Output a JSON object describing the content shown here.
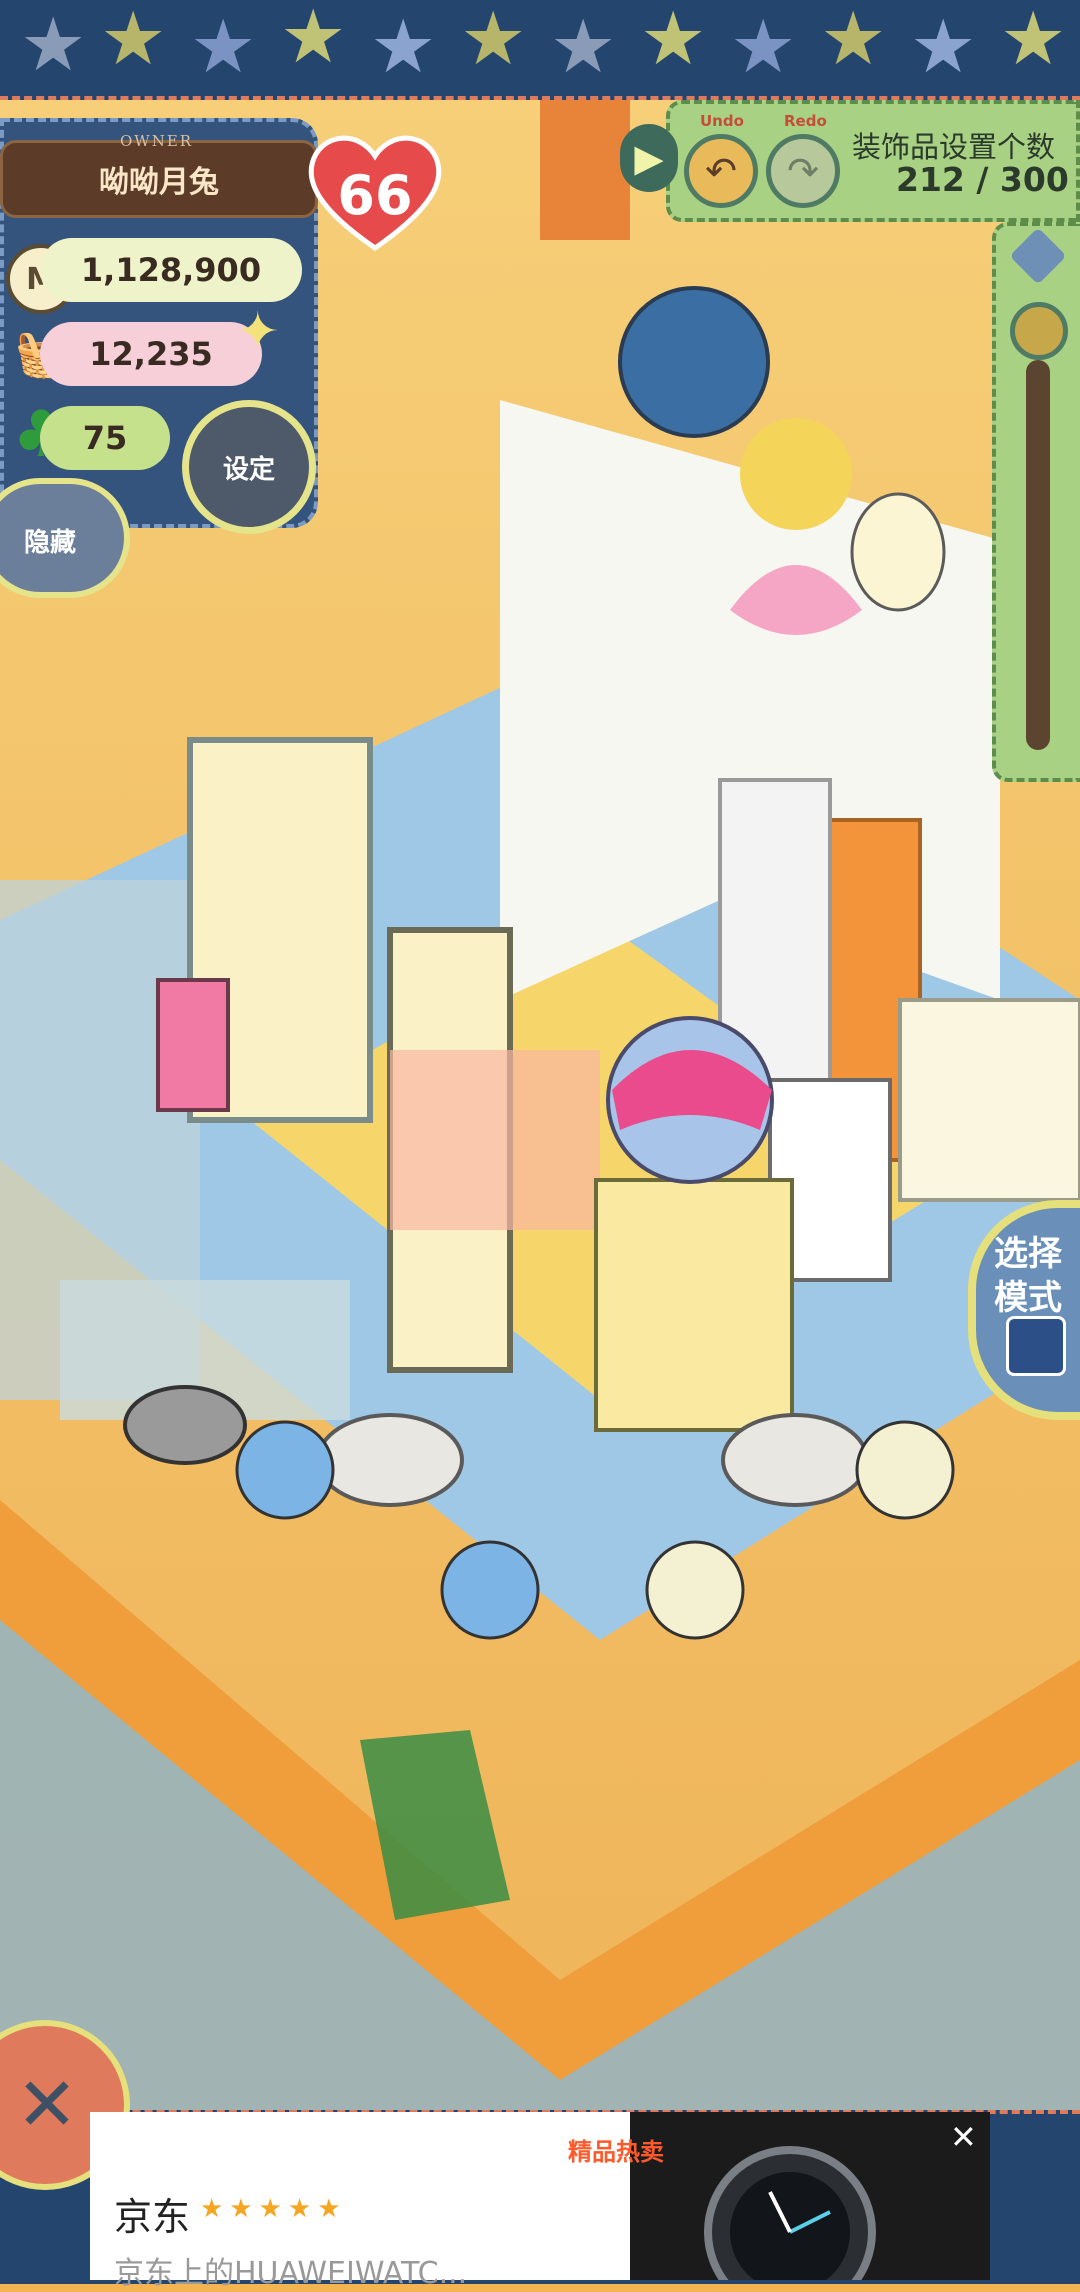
{
  "owner": {
    "label": "OWNER",
    "name": "呦呦月兔",
    "heart_level": "66",
    "money": "1,128,900",
    "gift_points": "12,235",
    "clover": "75"
  },
  "buttons": {
    "settings": "设定",
    "hide": "隐藏",
    "select_mode": "选择模式",
    "close": "✕",
    "undo_label": "Undo",
    "redo_label": "Redo"
  },
  "decoration": {
    "label": "装饰品设置个数",
    "count": "212 / 300"
  },
  "ad": {
    "badge": "精品热卖",
    "brand": "京东",
    "rating_stars": "★★★★★",
    "description": "京东上的HUAWEIWATC..."
  },
  "icons": {
    "coin": "coin-icon",
    "basket": "basket-icon",
    "clover": "clover-icon",
    "sparkle": "sparkle-icon",
    "undo": "undo-icon",
    "redo": "redo-icon",
    "play": "play-arrow-icon",
    "cube": "cube-icon",
    "close": "close-icon"
  },
  "colors": {
    "border_blue": "#24456e",
    "panel_green": "#a8d184",
    "accent_yellow": "#e5e07c",
    "heart_red": "#e64a4a"
  }
}
